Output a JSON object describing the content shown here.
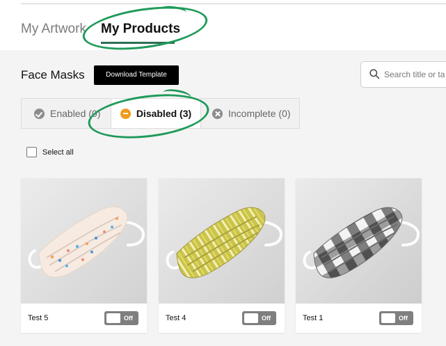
{
  "top_tabs": [
    {
      "label": "My Artwork"
    },
    {
      "label": "My Products"
    }
  ],
  "section": {
    "title": "Face Masks",
    "download_label": "Download Template"
  },
  "search": {
    "placeholder": "Search title or tag"
  },
  "status_tabs": [
    {
      "label": "Enabled (0)",
      "icon": "check-circle-icon"
    },
    {
      "label": "Disabled (3)",
      "icon": "minus-circle-icon"
    },
    {
      "label": "Incomplete (0)",
      "icon": "x-circle-icon"
    }
  ],
  "select_all": {
    "label": "Select all"
  },
  "products": [
    {
      "name": "Test 5",
      "toggle_label": "Off",
      "pattern": "confetti",
      "mask_color": "#f7ebe1",
      "accent": "#f5a25d"
    },
    {
      "name": "Test 4",
      "toggle_label": "Off",
      "pattern": "yellow-stripe",
      "mask_color": "#cbc44b",
      "accent": "#f5f0b8"
    },
    {
      "name": "Test 1",
      "toggle_label": "Off",
      "pattern": "gray-check",
      "mask_color": "#bfbfbf",
      "accent": "#4f4f4f"
    }
  ],
  "colors": {
    "active_underline": "#2f6e54",
    "annotation": "#1f9a5a",
    "toggle_off": "#7f7f7f"
  }
}
